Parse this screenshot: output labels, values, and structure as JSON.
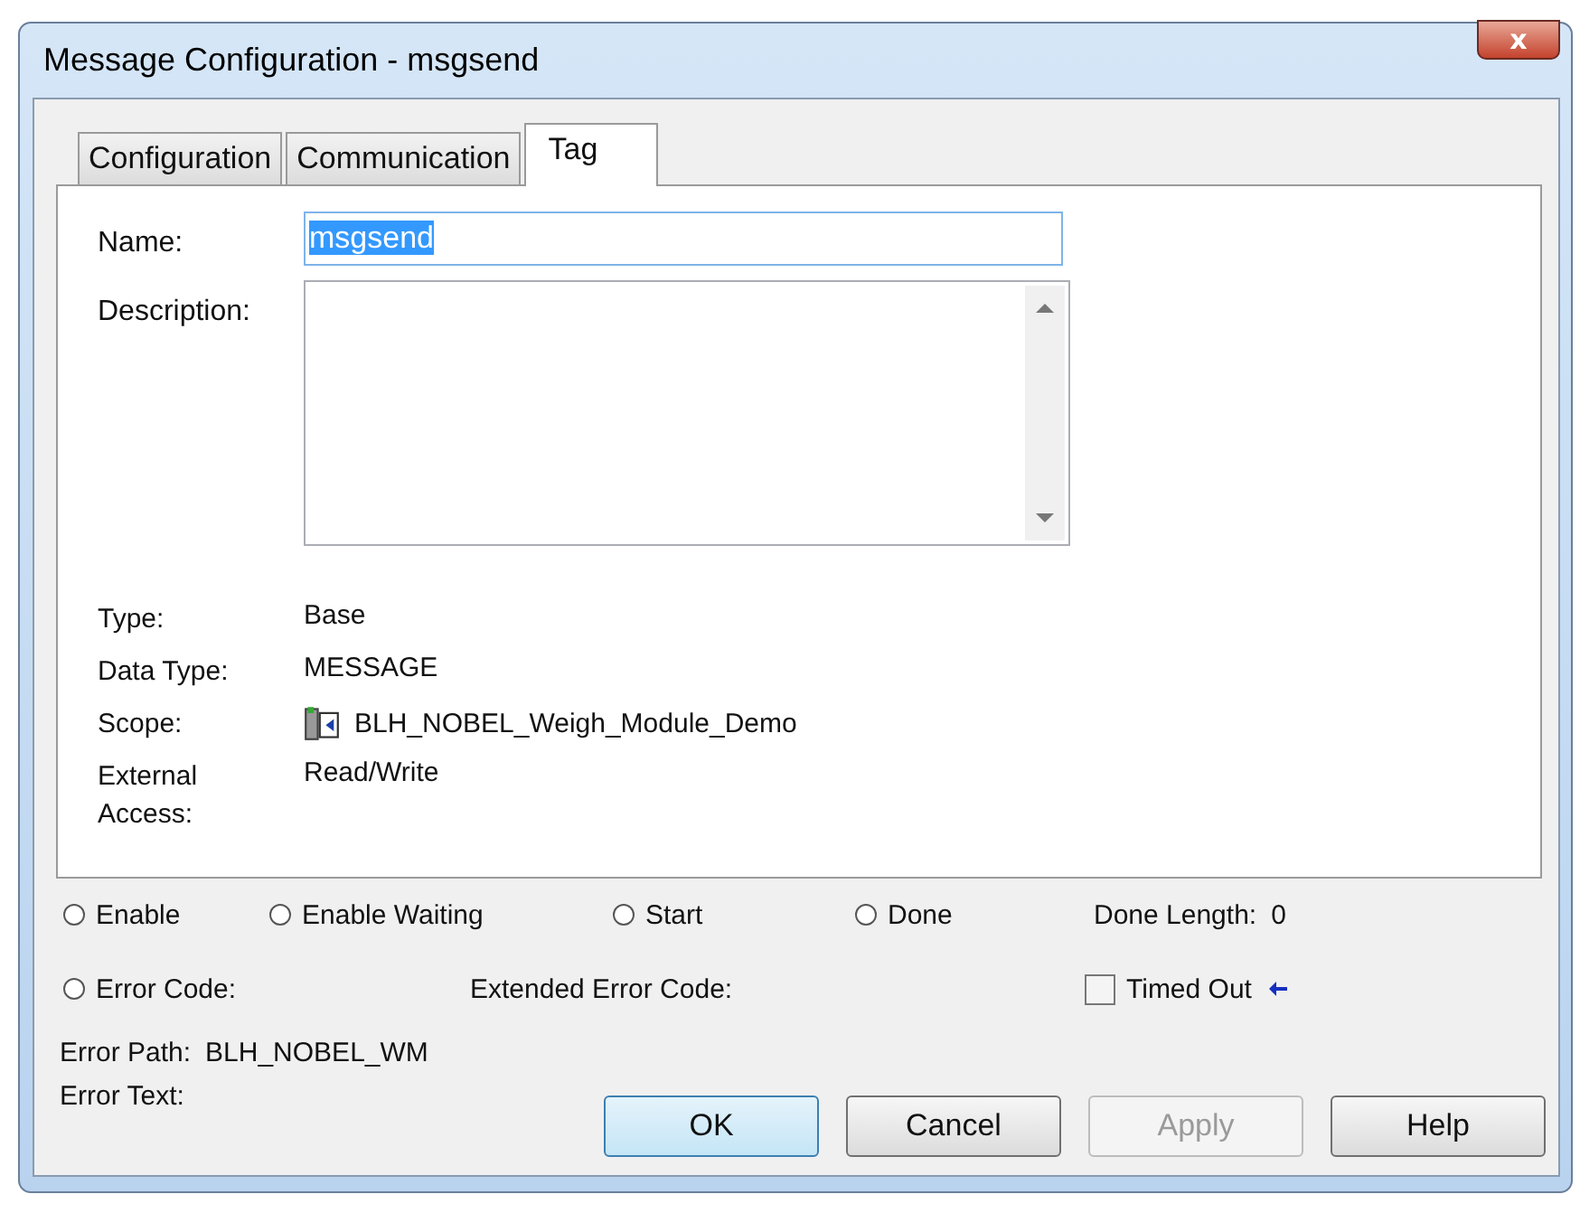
{
  "window": {
    "title": "Message Configuration - msgsend",
    "close": "x"
  },
  "tabs": [
    {
      "label": "Configuration",
      "selected": false
    },
    {
      "label": "Communication",
      "selected": false
    },
    {
      "label": "Tag",
      "selected": true
    }
  ],
  "name_field": {
    "label": "Name:",
    "value": "msgsend",
    "text_selected": true
  },
  "description_field": {
    "label": "Description:"
  },
  "properties": [
    {
      "label": "Type:",
      "value": "Base",
      "kind": "text"
    },
    {
      "label": "Data Type:",
      "value": "MESSAGE",
      "kind": "text"
    },
    {
      "label": "Scope:",
      "value": "BLH_NOBEL_Weigh_Module_Demo",
      "kind": "program"
    },
    {
      "label": "External Access:",
      "value": "Read/Write",
      "kind": "text"
    }
  ],
  "status_indicators": [
    {
      "label": "Enable",
      "checked": false
    },
    {
      "label": "Enable Waiting",
      "checked": false
    },
    {
      "label": "Start",
      "checked": false
    },
    {
      "label": "Done",
      "checked": false
    }
  ],
  "done_length": {
    "label": "Done Length:",
    "value": "0"
  },
  "error_code": {
    "label": "Error Code:",
    "checked": false
  },
  "extended_error_code": {
    "label": "Extended Error Code:"
  },
  "timed_out": {
    "label": "Timed Out",
    "checked": false
  },
  "error_path": {
    "label": "Error Path:",
    "value": "BLH_NOBEL_WM"
  },
  "error_text": {
    "label": "Error Text:"
  },
  "buttons": [
    {
      "label": "OK",
      "default": true,
      "disabled": false
    },
    {
      "label": "Cancel",
      "default": false,
      "disabled": false
    },
    {
      "label": "Apply",
      "default": false,
      "disabled": true
    },
    {
      "label": "Help",
      "default": false,
      "disabled": false
    }
  ]
}
